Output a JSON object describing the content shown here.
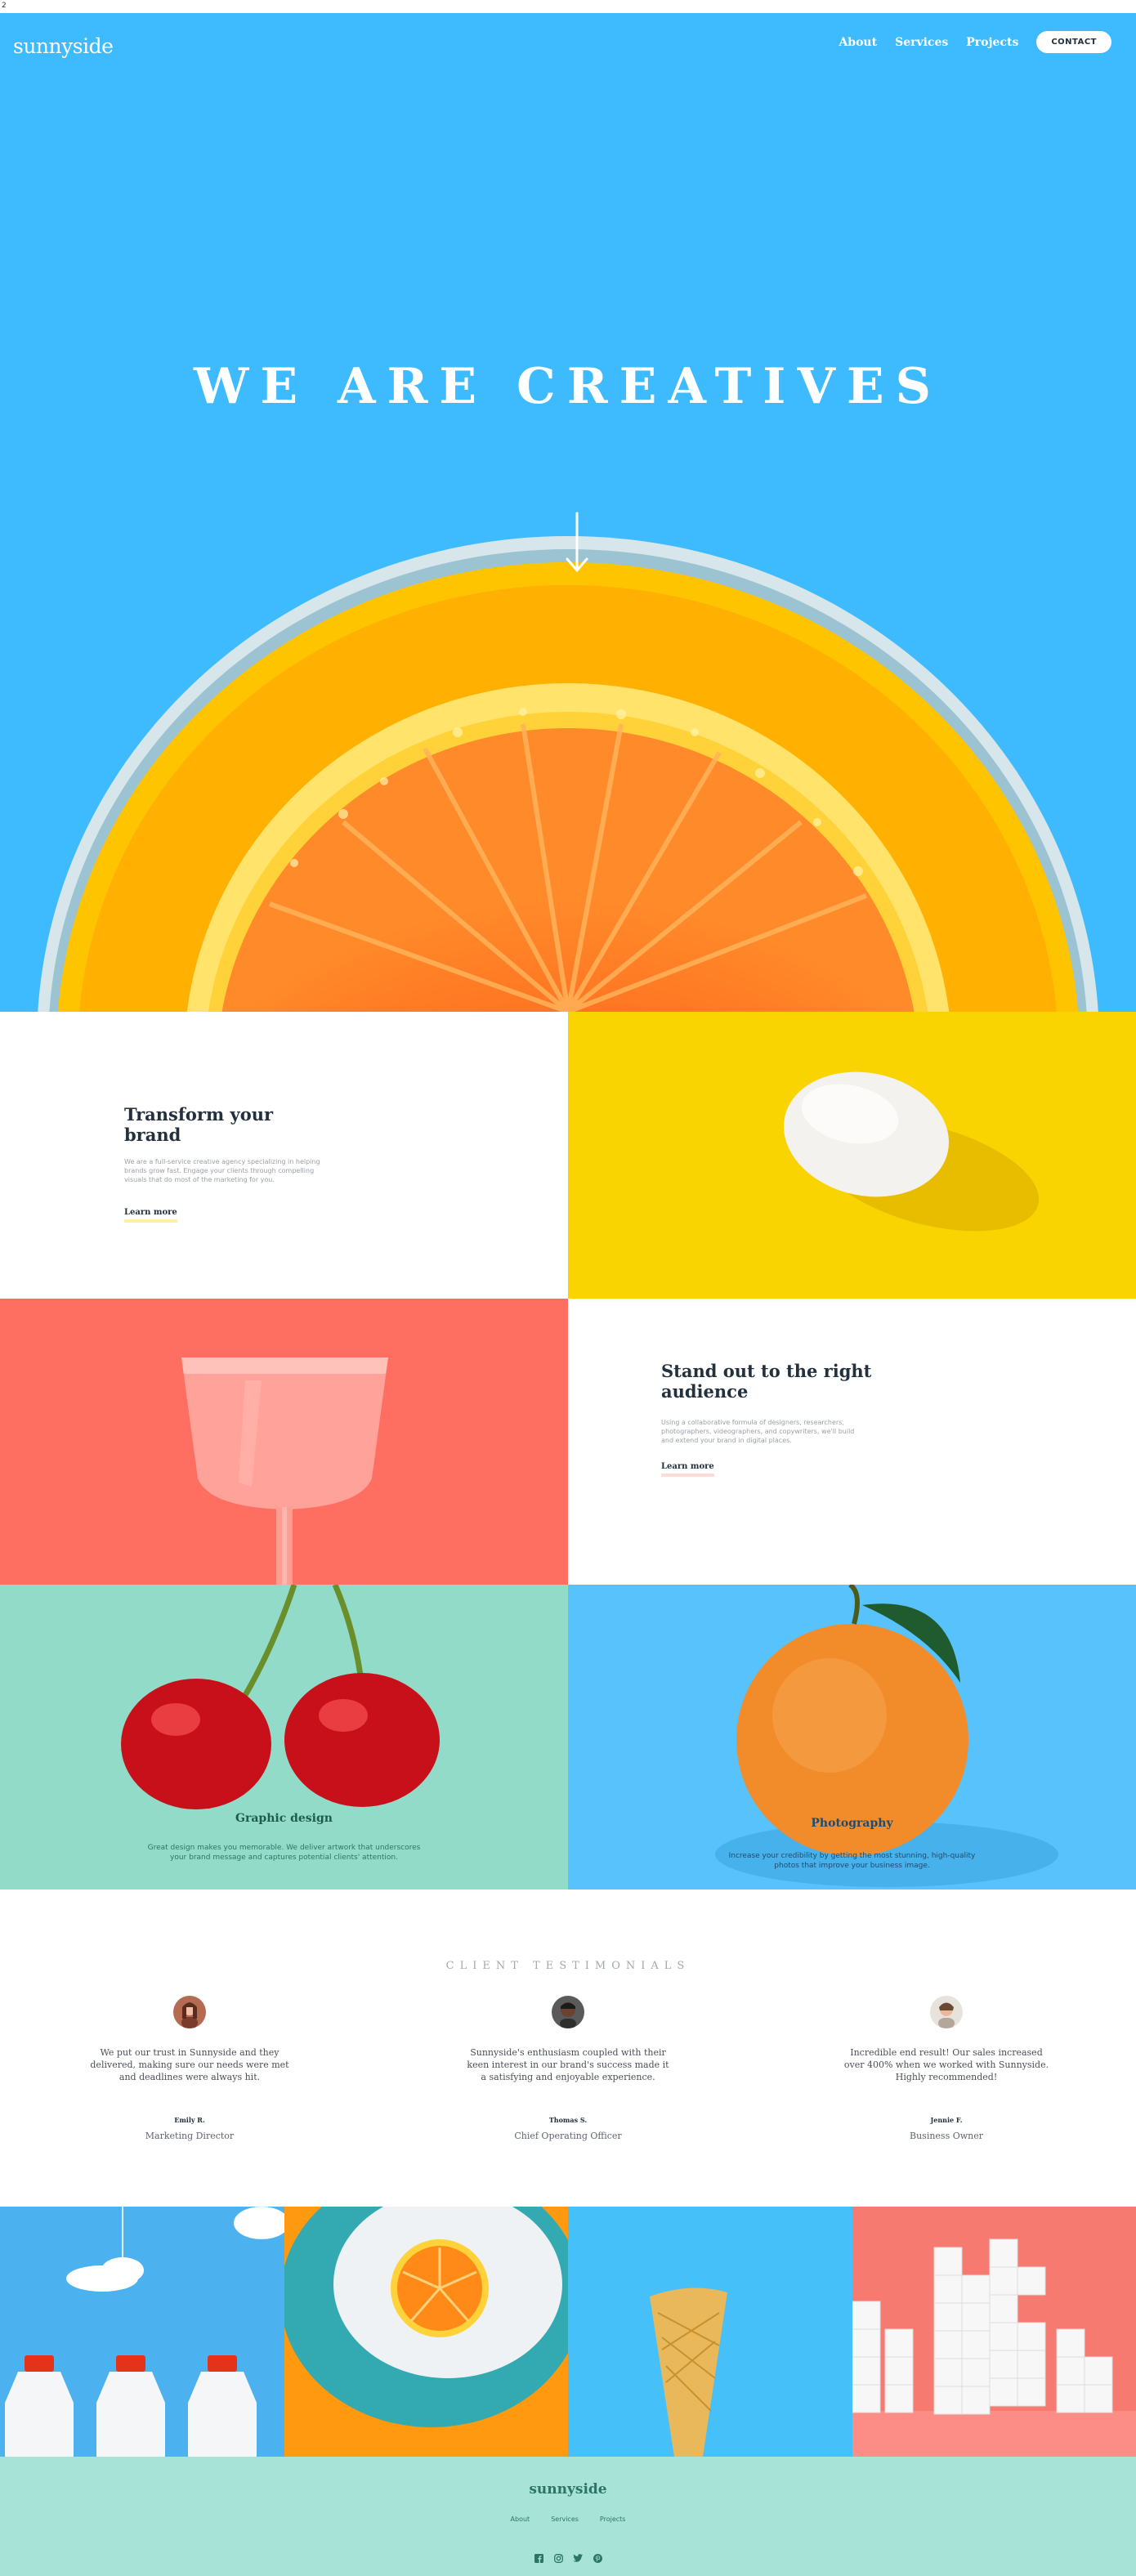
{
  "corner_mark": "2",
  "header": {
    "logo": "sunnyside",
    "nav": [
      "About",
      "Services",
      "Projects"
    ],
    "contact": "CONTACT"
  },
  "hero": {
    "title": "WE ARE CREATIVES"
  },
  "features": [
    {
      "title": "Transform your brand",
      "body": "We are a full-service creative agency specializing in helping brands grow fast. Engage your clients through compelling visuals that do most of the marketing for you.",
      "link": "Learn more"
    },
    {
      "title": "Stand out to the right audience",
      "body": "Using a collaborative formula of designers, researchers, photographers, videographers, and copywriters, we'll build and extend your brand in digital places.",
      "link": "Learn more"
    }
  ],
  "cards": [
    {
      "title": "Graphic design",
      "body": "Great design makes you memorable. We deliver artwork that underscores your brand message and captures potential clients' attention."
    },
    {
      "title": "Photography",
      "body": "Increase your credibility by getting the most stunning, high-quality photos that improve your business image."
    }
  ],
  "testimonials": {
    "heading": "CLIENT TESTIMONIALS",
    "items": [
      {
        "quote": "We put our trust in Sunnyside and they delivered, making sure our needs were met and deadlines were always hit.",
        "name": "Emily R.",
        "role": "Marketing Director"
      },
      {
        "quote": "Sunnyside's enthusiasm coupled with their keen interest in our brand's success made it a satisfying and enjoyable experience.",
        "name": "Thomas S.",
        "role": "Chief Operating Officer"
      },
      {
        "quote": "Incredible end result! Our sales increased over 400% when we worked with Sunnyside. Highly recommended!",
        "name": "Jennie F.",
        "role": "Business Owner"
      }
    ]
  },
  "footer": {
    "logo": "sunnyside",
    "nav": [
      "About",
      "Services",
      "Projects"
    ],
    "social": [
      "facebook-icon",
      "instagram-icon",
      "twitter-icon",
      "pinterest-icon"
    ]
  },
  "colors": {
    "hero_blue": "#3ebbfe",
    "yellow": "#fad400",
    "pink": "#fe6f62",
    "mint": "#93dbc9",
    "footer_mint": "#a8e3d8",
    "dark_text": "#23303e"
  }
}
